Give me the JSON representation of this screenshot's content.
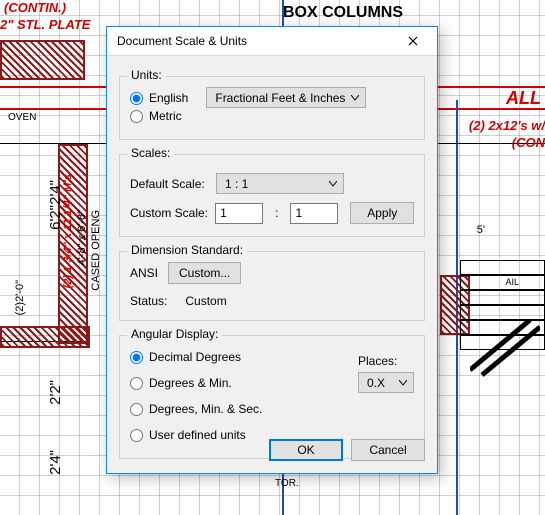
{
  "background": {
    "box_columns": "BOX COLUMNS",
    "contin": "(CONTIN.)",
    "stl_plate": "2\" STL. PLATE",
    "all": "ALL",
    "twox": "(2) 2x12's w/",
    "con": "(CON",
    "d_5": "5'",
    "d_24a": "2'4\"",
    "d_62": "6'2\"",
    "d_22": "2'2\"",
    "d_24b": "2'4\"",
    "d_220": "(2)2'-0\"",
    "cased": "CASED OPENG",
    "d_48": "4'-8\" x 6'-8\"",
    "rough": "(2) 1 3/4\" x 11 1/4\" M's",
    "oven": "OVEN",
    "ail": "AIL",
    "tor": "TOR."
  },
  "dialog": {
    "title": "Document Scale & Units",
    "close_icon": "close",
    "units": {
      "legend": "Units:",
      "english": "English",
      "metric": "Metric",
      "format": "Fractional Feet & Inches"
    },
    "scales": {
      "legend": "Scales:",
      "default_label": "Default Scale:",
      "custom_label": "Custom Scale:",
      "default_value": "1 : 1",
      "custom_a": "1",
      "custom_b": "1",
      "colon": ":",
      "apply": "Apply"
    },
    "dimstd": {
      "legend": "Dimension Standard:",
      "ansi": "ANSI",
      "custom_btn": "Custom...",
      "status_label": "Status:",
      "status_value": "Custom"
    },
    "angular": {
      "legend": "Angular Display:",
      "opt1": "Decimal Degrees",
      "opt2": "Degrees & Min.",
      "opt3": "Degrees, Min. & Sec.",
      "opt4": "User defined units",
      "places_label": "Places:",
      "places_value": "0.X"
    },
    "footer": {
      "ok": "OK",
      "cancel": "Cancel"
    }
  }
}
